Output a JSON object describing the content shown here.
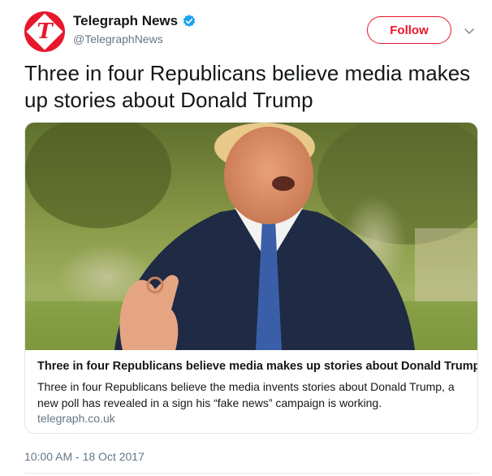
{
  "account": {
    "display_name": "Telegraph News",
    "handle": "@TelegraphNews",
    "avatar_letter": "T",
    "verified": true,
    "verified_icon": "verified-badge-icon",
    "brand_color": "#e8172b"
  },
  "actions": {
    "follow_label": "Follow",
    "more_icon": "chevron-down-icon"
  },
  "tweet": {
    "text": "Three in four Republicans believe media makes up stories about Donald Trump",
    "timestamp": "10:00 AM - 18 Oct 2017"
  },
  "card": {
    "title": "Three in four Republicans believe media makes up stories about Donald Trump",
    "description": "Three in four Republicans believe the media invents stories about Donald Trump, a new poll has revealed in a sign his “fake news” campaign is working.",
    "domain": "telegraph.co.uk"
  },
  "colors": {
    "text_primary": "#14171a",
    "text_secondary": "#657786",
    "border": "#e1e8ed",
    "verified_blue": "#1da1f2"
  }
}
